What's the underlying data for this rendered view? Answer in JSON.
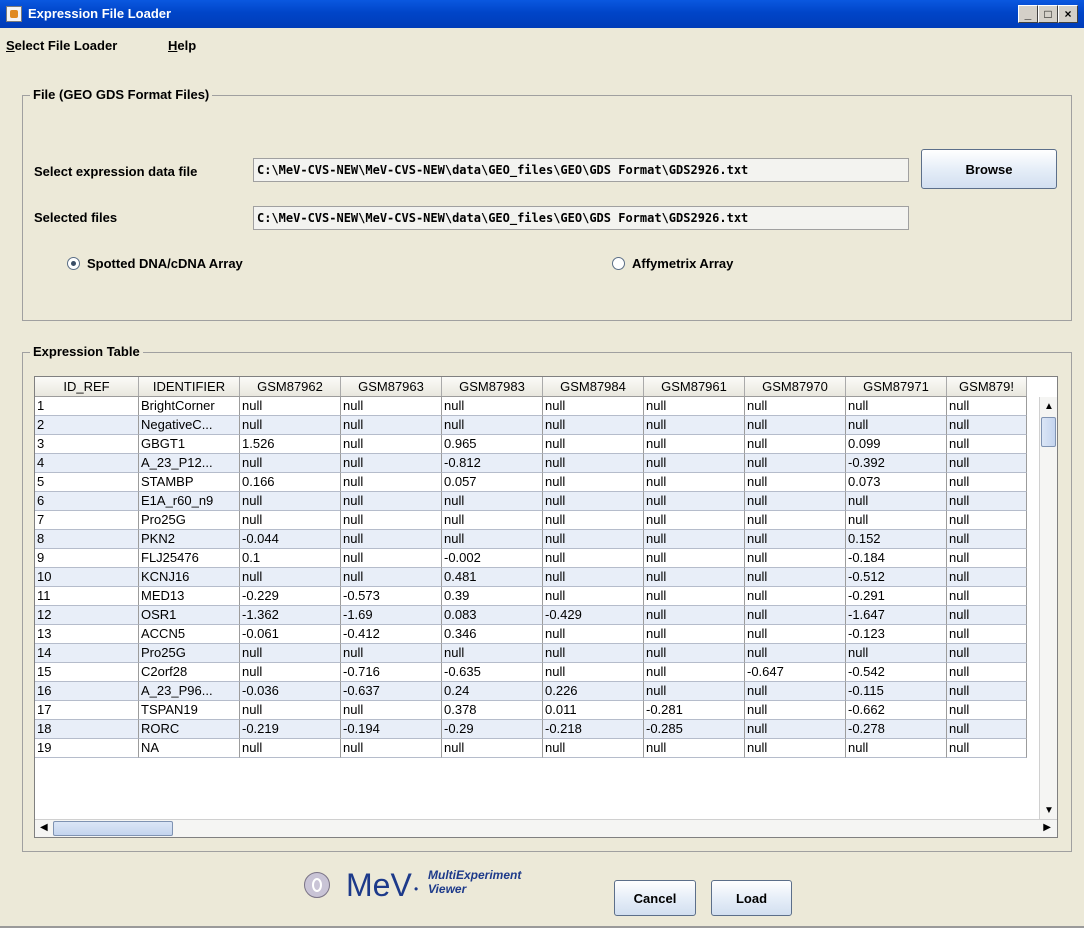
{
  "window": {
    "title": "Expression File Loader",
    "controls": [
      "_",
      "□",
      "×"
    ]
  },
  "menu": [
    {
      "ul": "S",
      "rest": "elect File Loader"
    },
    {
      "ul": "H",
      "rest": "elp"
    }
  ],
  "file_group": {
    "title": "File   (GEO GDS Format Files)",
    "select_label": "Select expression data file",
    "select_value": "C:\\MeV-CVS-NEW\\MeV-CVS-NEW\\data\\GEO_files\\GEO\\GDS Format\\GDS2926.txt",
    "browse_label": "Browse",
    "selected_label": "Selected files",
    "selected_value": "C:\\MeV-CVS-NEW\\MeV-CVS-NEW\\data\\GEO_files\\GEO\\GDS Format\\GDS2926.txt",
    "radio_spotted": "Spotted DNA/cDNA Array",
    "radio_affy": "Affymetrix Array",
    "selected_radio": "spotted"
  },
  "table_group": {
    "title": "Expression Table",
    "columns": [
      "ID_REF",
      "IDENTIFIER",
      "GSM87962",
      "GSM87963",
      "GSM87983",
      "GSM87984",
      "GSM87961",
      "GSM87970",
      "GSM87971",
      "GSM879!"
    ],
    "rows": [
      [
        "1",
        "BrightCorner",
        "null",
        "null",
        "null",
        "null",
        "null",
        "null",
        "null",
        "null"
      ],
      [
        "2",
        "NegativeC...",
        "null",
        "null",
        "null",
        "null",
        "null",
        "null",
        "null",
        "null"
      ],
      [
        "3",
        "GBGT1",
        "1.526",
        "null",
        "0.965",
        "null",
        "null",
        "null",
        "0.099",
        "null"
      ],
      [
        "4",
        "A_23_P12...",
        "null",
        "null",
        "-0.812",
        "null",
        "null",
        "null",
        "-0.392",
        "null"
      ],
      [
        "5",
        "STAMBP",
        "0.166",
        "null",
        "0.057",
        "null",
        "null",
        "null",
        "0.073",
        "null"
      ],
      [
        "6",
        "E1A_r60_n9",
        "null",
        "null",
        "null",
        "null",
        "null",
        "null",
        "null",
        "null"
      ],
      [
        "7",
        "Pro25G",
        "null",
        "null",
        "null",
        "null",
        "null",
        "null",
        "null",
        "null"
      ],
      [
        "8",
        "PKN2",
        "-0.044",
        "null",
        "null",
        "null",
        "null",
        "null",
        "0.152",
        "null"
      ],
      [
        "9",
        "FLJ25476",
        "0.1",
        "null",
        "-0.002",
        "null",
        "null",
        "null",
        "-0.184",
        "null"
      ],
      [
        "10",
        "KCNJ16",
        "null",
        "null",
        "0.481",
        "null",
        "null",
        "null",
        "-0.512",
        "null"
      ],
      [
        "11",
        "MED13",
        "-0.229",
        "-0.573",
        "0.39",
        "null",
        "null",
        "null",
        "-0.291",
        "null"
      ],
      [
        "12",
        "OSR1",
        "-1.362",
        "-1.69",
        "0.083",
        "-0.429",
        "null",
        "null",
        "-1.647",
        "null"
      ],
      [
        "13",
        "ACCN5",
        "-0.061",
        "-0.412",
        "0.346",
        "null",
        "null",
        "null",
        "-0.123",
        "null"
      ],
      [
        "14",
        "Pro25G",
        "null",
        "null",
        "null",
        "null",
        "null",
        "null",
        "null",
        "null"
      ],
      [
        "15",
        "C2orf28",
        "null",
        "-0.716",
        "-0.635",
        "null",
        "null",
        "-0.647",
        "-0.542",
        "null"
      ],
      [
        "16",
        "A_23_P96...",
        "-0.036",
        "-0.637",
        "0.24",
        "0.226",
        "null",
        "null",
        "-0.115",
        "null"
      ],
      [
        "17",
        "TSPAN19",
        "null",
        "null",
        "0.378",
        "0.011",
        "-0.281",
        "null",
        "-0.662",
        "null"
      ],
      [
        "18",
        "RORC",
        "-0.219",
        "-0.194",
        "-0.29",
        "-0.218",
        "-0.285",
        "null",
        "-0.278",
        "null"
      ],
      [
        "19",
        "NA",
        "null",
        "null",
        "null",
        "null",
        "null",
        "null",
        "null",
        "null"
      ]
    ]
  },
  "footer": {
    "logo_text": "MeV",
    "logo_star": "•",
    "logo_sub1": "MultiExperiment",
    "logo_sub2": "Viewer",
    "cancel_label": "Cancel",
    "load_label": "Load"
  },
  "scroll_arrows": {
    "up": "▲",
    "down": "▼",
    "left": "◀",
    "right": "▶"
  }
}
